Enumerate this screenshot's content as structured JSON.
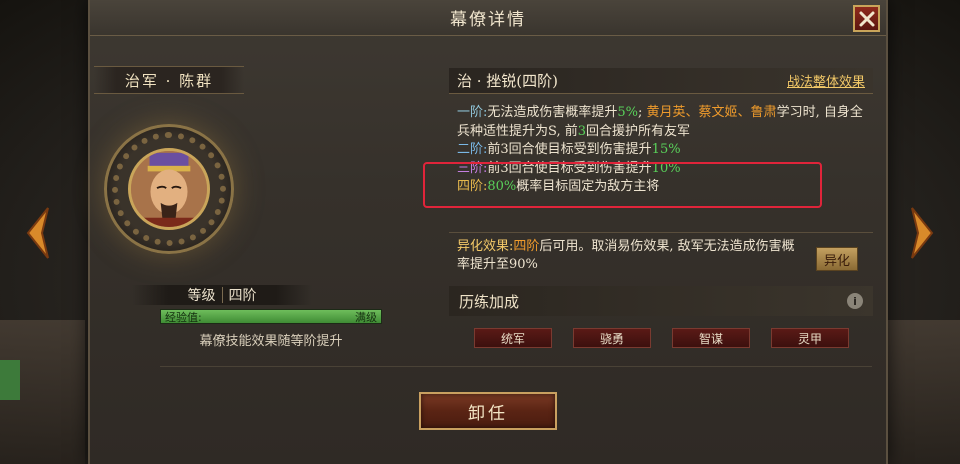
{
  "dialog": {
    "title": "幕僚详情",
    "close_icon": "close-icon"
  },
  "advisor": {
    "name": "治军 · 陈群",
    "level_label": "等级",
    "level_value": "四阶",
    "exp_label": "经验值:",
    "exp_status": "满级",
    "exp_fill": 1.0,
    "note": "幕僚技能效果随等阶提升"
  },
  "skill": {
    "title": "治 · 挫锐(四阶)",
    "overview_link": "战法整体效果",
    "tier1": {
      "label": "一阶:",
      "text_a": "无法造成伤害概率提升",
      "value_a": "5%",
      "text_b": "; ",
      "heroes": "黄月英、蔡文姬、鲁肃",
      "text_c": "学习时, 自身全兵种适性提升为S, 前",
      "turns": "3",
      "text_d": "回合援护所有友军"
    },
    "tier2": {
      "label": "二阶:",
      "text": "前3回合使目标受到伤害提升",
      "value": "15%"
    },
    "tier3": {
      "label": "三阶:",
      "text": "前3回合使目标受到伤害提升",
      "value": "10%"
    },
    "tier4": {
      "label": "四阶:",
      "value": "80%",
      "text": "概率目标固定为敌方主将"
    }
  },
  "variant": {
    "label": "异化效果:",
    "tier": "四阶",
    "text_a": "后可用。取消易伤效果, 敌军无法造成伤害概率提升至90%",
    "button_label": "异化"
  },
  "training": {
    "title": "历练加成",
    "info_icon": "info-icon",
    "stats": [
      "统军",
      "骁勇",
      "智谋",
      "灵甲"
    ]
  },
  "actions": {
    "dismiss_label": "卸任"
  },
  "colors": {
    "highlight_border": "#e0243a",
    "value_green": "#59d15a",
    "hero_orange": "#ef9b2c",
    "link_gold": "#f3c968"
  }
}
